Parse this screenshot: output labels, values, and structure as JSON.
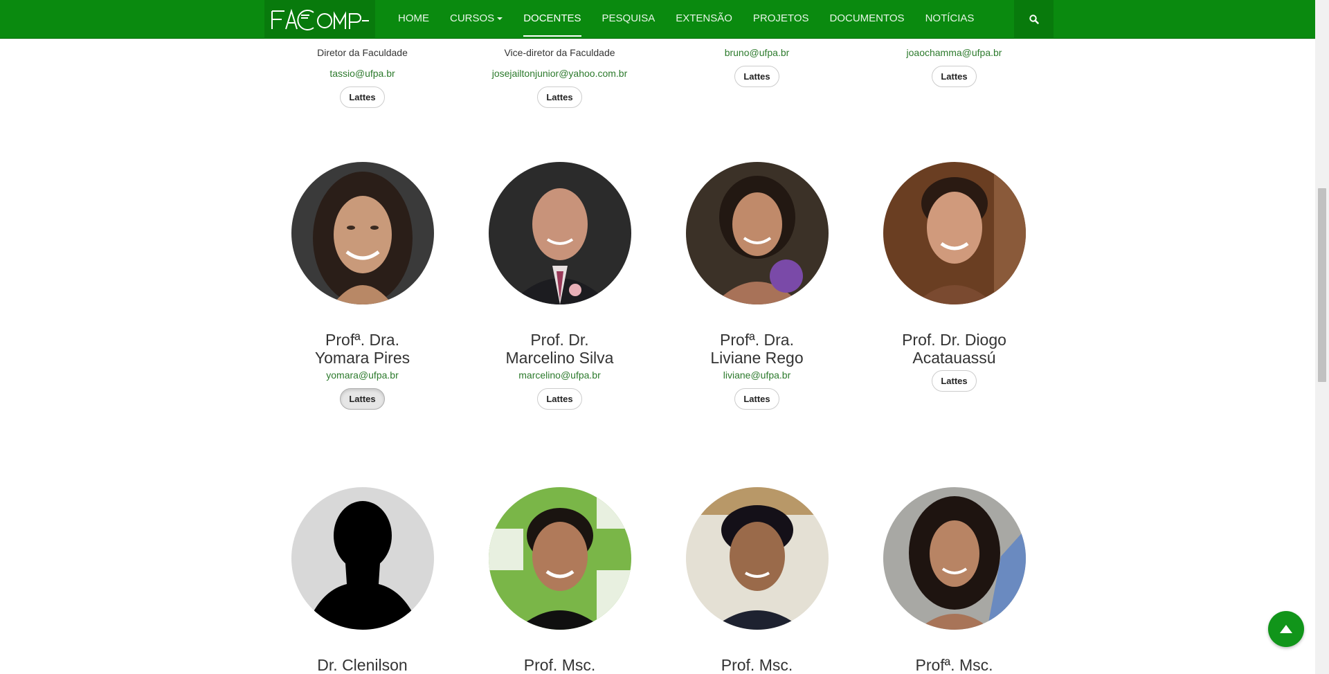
{
  "nav": {
    "logo": "FACOMP",
    "items": [
      {
        "label": "HOME",
        "active": false
      },
      {
        "label": "CURSOS",
        "active": false,
        "dropdown": true
      },
      {
        "label": "DOCENTES",
        "active": true
      },
      {
        "label": "PESQUISA",
        "active": false
      },
      {
        "label": "EXTENSÃO",
        "active": false
      },
      {
        "label": "PROJETOS",
        "active": false
      },
      {
        "label": "DOCUMENTOS",
        "active": false
      },
      {
        "label": "NOTÍCIAS",
        "active": false
      }
    ],
    "search_icon": "search-icon"
  },
  "top_row": [
    {
      "role": "Diretor da Faculdade",
      "email": "tassio@ufpa.br",
      "button": "Lattes"
    },
    {
      "role": "Vice-diretor da Faculdade",
      "email": "josejailtonjunior@yahoo.com.br",
      "button": "Lattes"
    },
    {
      "email": "bruno@ufpa.br",
      "button": "Lattes"
    },
    {
      "email": "joaochamma@ufpa.br",
      "button": "Lattes"
    }
  ],
  "mid_row": [
    {
      "name_line1": "Profª. Dra.",
      "name_line2": "Yomara Pires",
      "email": "yomara@ufpa.br",
      "button": "Lattes"
    },
    {
      "name_line1": "Prof. Dr.",
      "name_line2": "Marcelino Silva",
      "email": "marcelino@ufpa.br",
      "button": "Lattes"
    },
    {
      "name_line1": "Profª. Dra.",
      "name_line2": "Liviane Rego",
      "email": "liviane@ufpa.br",
      "button": "Lattes"
    },
    {
      "name_line1": "Prof. Dr. Diogo",
      "name_line2": "Acatauassú",
      "button": "Lattes"
    }
  ],
  "bottom_row": [
    {
      "name_line1": "Dr. Clenilson"
    },
    {
      "name_line1": "Prof. Msc."
    },
    {
      "name_line1": "Prof. Msc."
    },
    {
      "name_line1": "Profª. Msc."
    }
  ],
  "colors": {
    "brand_green": "#0a8a0f",
    "link_green": "#2c7a2c"
  }
}
